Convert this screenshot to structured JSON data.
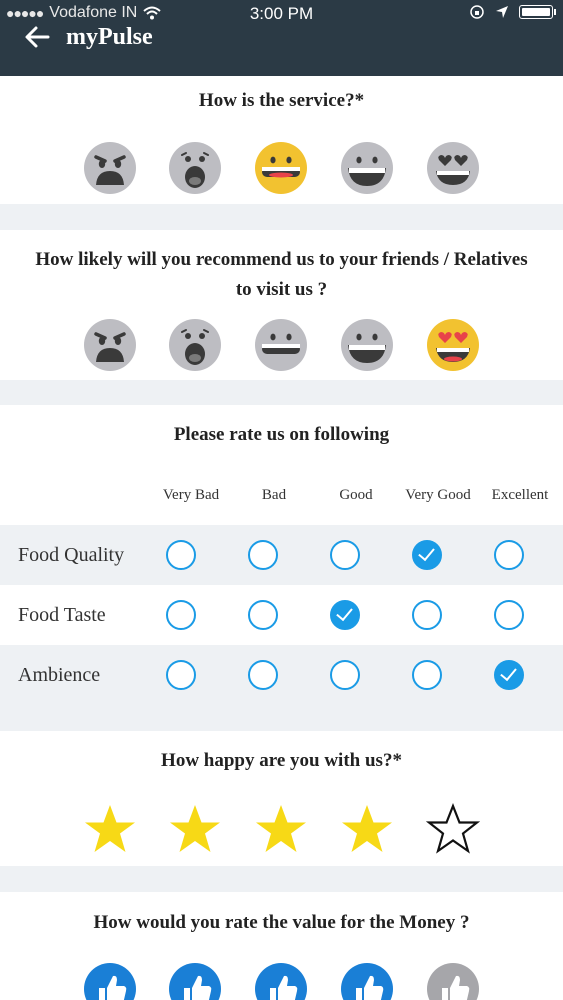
{
  "status_bar": {
    "carrier": "Vodafone IN",
    "time": "3:00 PM"
  },
  "header": {
    "title": "myPulse",
    "back_icon": "back-arrow-icon"
  },
  "colors": {
    "header_bg": "#2b3a45",
    "accent": "#1a9be6",
    "star": "#f7d916",
    "emoji_selected": "#f2c230",
    "emoji_default": "#bdbdc2"
  },
  "service": {
    "question": "How is the service?*",
    "options": [
      "angry-face-icon",
      "surprised-face-icon",
      "neutral-face-icon",
      "grin-face-icon",
      "heart-eyes-face-icon"
    ],
    "selected_index": 2
  },
  "recommend": {
    "question_line1": "How likely will you recommend us to your friends / Relatives",
    "question_line2": "to visit us ?",
    "options": [
      "angry-face-icon",
      "surprised-face-icon",
      "neutral-face-icon",
      "grin-face-icon",
      "heart-eyes-face-icon"
    ],
    "selected_index": 4
  },
  "rating_table": {
    "title": "Please rate us on following",
    "columns": [
      "Very Bad",
      "Bad",
      "Good",
      "Very Good",
      "Excellent"
    ],
    "rows": [
      {
        "label": "Food Quality",
        "selected_index": 3
      },
      {
        "label": "Food Taste",
        "selected_index": 2
      },
      {
        "label": "Ambience",
        "selected_index": 4
      }
    ]
  },
  "happiness": {
    "question": "How happy are you with us?*",
    "rating": 4,
    "max": 5
  },
  "value": {
    "question": "How would you rate the value for the Money ?",
    "rating": 4,
    "max": 5
  }
}
